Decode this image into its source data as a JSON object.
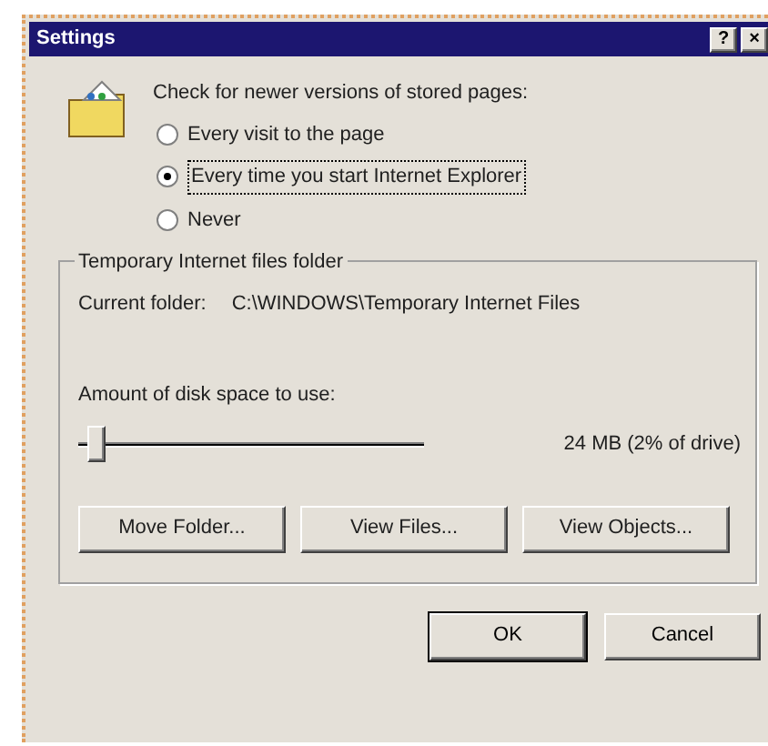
{
  "window": {
    "title": "Settings",
    "buttons": [
      "?",
      "×"
    ]
  },
  "check": {
    "label": "Check for newer versions of stored pages:",
    "options": [
      {
        "label": "Every visit to the page",
        "selected": false
      },
      {
        "label": "Every time you start Internet Explorer",
        "selected": true
      },
      {
        "label": "Never",
        "selected": false
      }
    ]
  },
  "temp_files": {
    "title": "Temporary Internet files folder",
    "current_label": "Current folder:",
    "current_path": "C:\\WINDOWS\\Temporary Internet Files",
    "disk_label": "Amount of disk space to use:",
    "disk_slider": {
      "level": 0.03
    },
    "disk_reading": "24 MB (2% of drive)",
    "buttons": [
      "Move Folder...",
      "View Files...",
      "View Objects..."
    ]
  },
  "buttons": [
    "OK",
    "Cancel"
  ]
}
